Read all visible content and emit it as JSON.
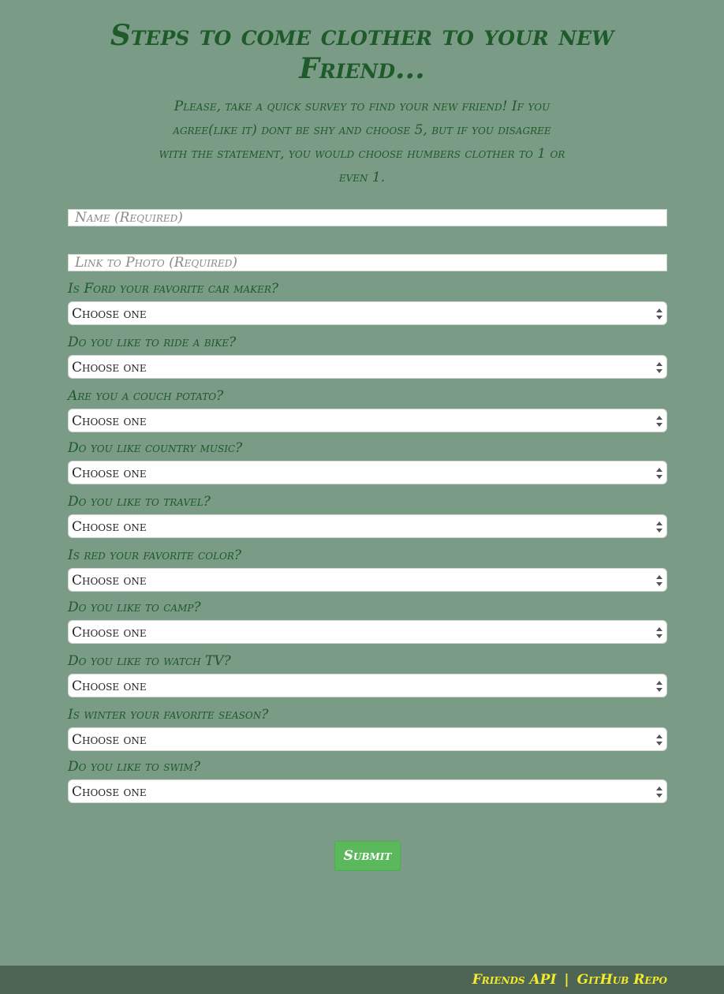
{
  "header": {
    "title": "Steps to come clother to your new Friend...",
    "intro": "Please, take a quick survey to find your new friend! If you agree(like it) dont be shy and choose 5, but if you disagree with the statement, you would choose humbers clother to 1 or even 1."
  },
  "form": {
    "name_placeholder": "Name (Required)",
    "photo_placeholder": "Link to Photo (Required)",
    "select_default": "Choose one",
    "questions": [
      {
        "label": "Is Ford your favorite car maker?",
        "value": "Choose one"
      },
      {
        "label": "Do you like to ride a bike?",
        "value": "Choose one"
      },
      {
        "label": "Are you a couch potato?",
        "value": "Choose one"
      },
      {
        "label": "Do you like country music?",
        "value": "Choose one"
      },
      {
        "label": "Do you like to travel?",
        "value": "Choose one"
      },
      {
        "label": "Is red your favorite color?",
        "value": "Choose one"
      },
      {
        "label": "Do you like to camp?",
        "value": "Choose one"
      },
      {
        "label": "Do you like to watch TV?",
        "value": "Choose one"
      },
      {
        "label": "Is winter your favorite season?",
        "value": "Choose one"
      },
      {
        "label": "Do you like to swim?",
        "value": "Choose one"
      }
    ],
    "submit_label": "Submit"
  },
  "footer": {
    "api_link": "Friends API",
    "separator": "|",
    "repo_link": "GitHub Repo"
  },
  "colors": {
    "background": "#7a9b85",
    "heading": "#1f5a2b",
    "submit": "#5cb85c",
    "footer_bg": "#4e6555",
    "footer_link": "#f2ea2a"
  },
  "icons": {
    "select_arrow": "updown-icon"
  }
}
